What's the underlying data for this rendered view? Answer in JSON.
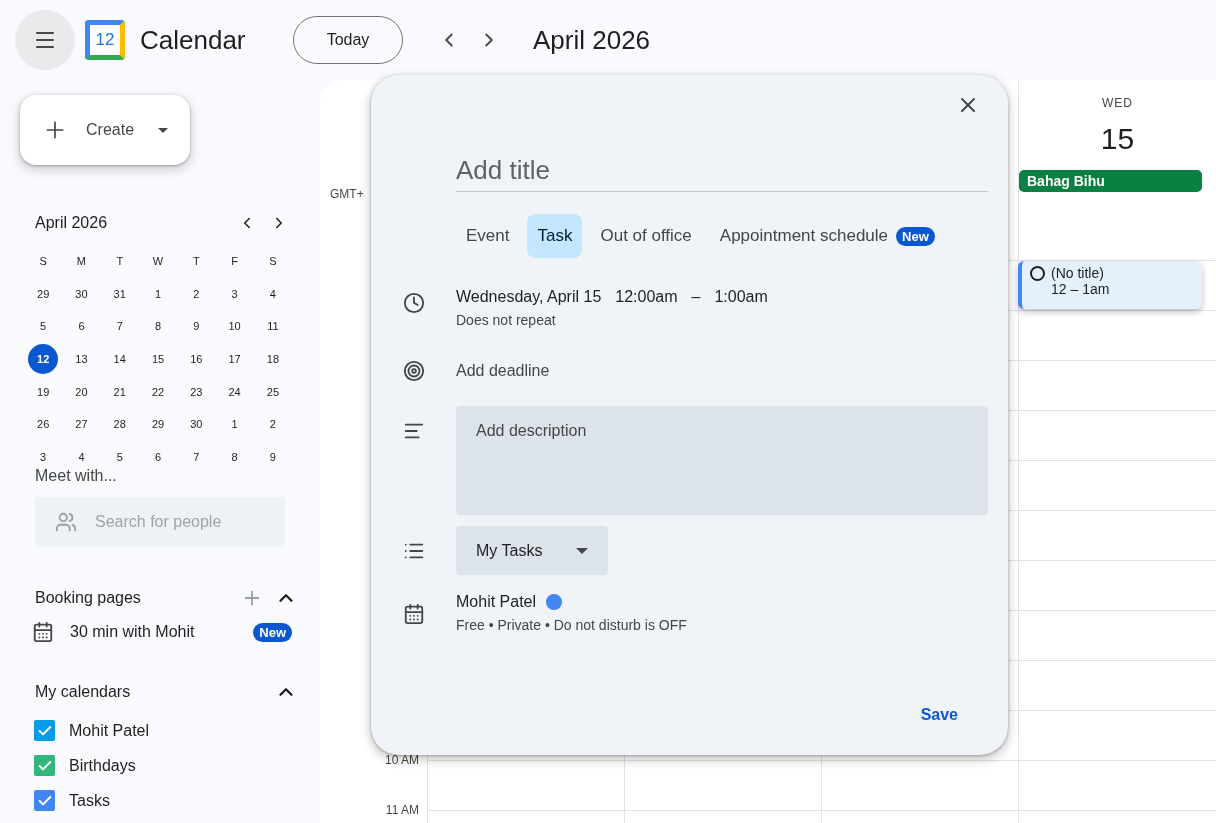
{
  "header": {
    "logo_text": "12",
    "app_name": "Calendar",
    "today_button": "Today",
    "current_period": "April 2026"
  },
  "create_button": {
    "label": "Create"
  },
  "mini_calendar": {
    "title": "April 2026",
    "weekdays": [
      "S",
      "M",
      "T",
      "W",
      "T",
      "F",
      "S"
    ],
    "weeks": [
      [
        {
          "day": "29",
          "selected": false
        },
        {
          "day": "30",
          "selected": false
        },
        {
          "day": "31",
          "selected": false
        },
        {
          "day": "1",
          "selected": false
        },
        {
          "day": "2",
          "selected": false
        },
        {
          "day": "3",
          "selected": false
        },
        {
          "day": "4",
          "selected": false
        }
      ],
      [
        {
          "day": "5",
          "selected": false
        },
        {
          "day": "6",
          "selected": false
        },
        {
          "day": "7",
          "selected": false
        },
        {
          "day": "8",
          "selected": false
        },
        {
          "day": "9",
          "selected": false
        },
        {
          "day": "10",
          "selected": false
        },
        {
          "day": "11",
          "selected": false
        }
      ],
      [
        {
          "day": "12",
          "selected": true
        },
        {
          "day": "13",
          "selected": false
        },
        {
          "day": "14",
          "selected": false
        },
        {
          "day": "15",
          "selected": false
        },
        {
          "day": "16",
          "selected": false
        },
        {
          "day": "17",
          "selected": false
        },
        {
          "day": "18",
          "selected": false
        }
      ],
      [
        {
          "day": "19",
          "selected": false
        },
        {
          "day": "20",
          "selected": false
        },
        {
          "day": "21",
          "selected": false
        },
        {
          "day": "22",
          "selected": false
        },
        {
          "day": "23",
          "selected": false
        },
        {
          "day": "24",
          "selected": false
        },
        {
          "day": "25",
          "selected": false
        }
      ],
      [
        {
          "day": "26",
          "selected": false
        },
        {
          "day": "27",
          "selected": false
        },
        {
          "day": "28",
          "selected": false
        },
        {
          "day": "29",
          "selected": false
        },
        {
          "day": "30",
          "selected": false
        },
        {
          "day": "1",
          "selected": false
        },
        {
          "day": "2",
          "selected": false
        }
      ],
      [
        {
          "day": "3",
          "selected": false
        },
        {
          "day": "4",
          "selected": false
        },
        {
          "day": "5",
          "selected": false
        },
        {
          "day": "6",
          "selected": false
        },
        {
          "day": "7",
          "selected": false
        },
        {
          "day": "8",
          "selected": false
        },
        {
          "day": "9",
          "selected": false
        }
      ]
    ]
  },
  "meet_with": {
    "title": "Meet with...",
    "search_placeholder": "Search for people"
  },
  "booking_pages": {
    "title": "Booking pages",
    "expanded": true,
    "items": [
      {
        "label": "30 min with Mohit",
        "badge": "New"
      }
    ]
  },
  "my_calendars": {
    "title": "My calendars",
    "expanded": true,
    "items": [
      {
        "label": "Mohit Patel",
        "checked": true,
        "color": "#039be5"
      },
      {
        "label": "Birthdays",
        "checked": true,
        "color": "#33b679"
      },
      {
        "label": "Tasks",
        "checked": true,
        "color": "#4285f4"
      }
    ]
  },
  "week_view": {
    "timezone": "GMT+",
    "day": {
      "weekday": "WED",
      "date": "15"
    },
    "all_day_events": [
      {
        "title": "Bahag Bihu",
        "color": "#0b8043"
      }
    ],
    "events": [
      {
        "title": "(No title)",
        "time": "12 – 1am"
      }
    ],
    "hour_labels": [
      "10 AM",
      "11 AM"
    ]
  },
  "dialog": {
    "title_placeholder": "Add title",
    "tabs": [
      {
        "label": "Event",
        "selected": false
      },
      {
        "label": "Task",
        "selected": true
      },
      {
        "label": "Out of office",
        "selected": false
      },
      {
        "label": "Appointment schedule",
        "selected": false,
        "badge": "New"
      }
    ],
    "date": "Wednesday, April 15",
    "start": "12:00am",
    "dash": "–",
    "end": "1:00am",
    "repeat": "Does not repeat",
    "deadline": "Add deadline",
    "description_placeholder": "Add description",
    "task_list": "My Tasks",
    "calendar": {
      "name": "Mohit Patel",
      "color": "#4285f4",
      "details": "Free • Private • Do not disturb is OFF"
    },
    "save": "Save"
  }
}
